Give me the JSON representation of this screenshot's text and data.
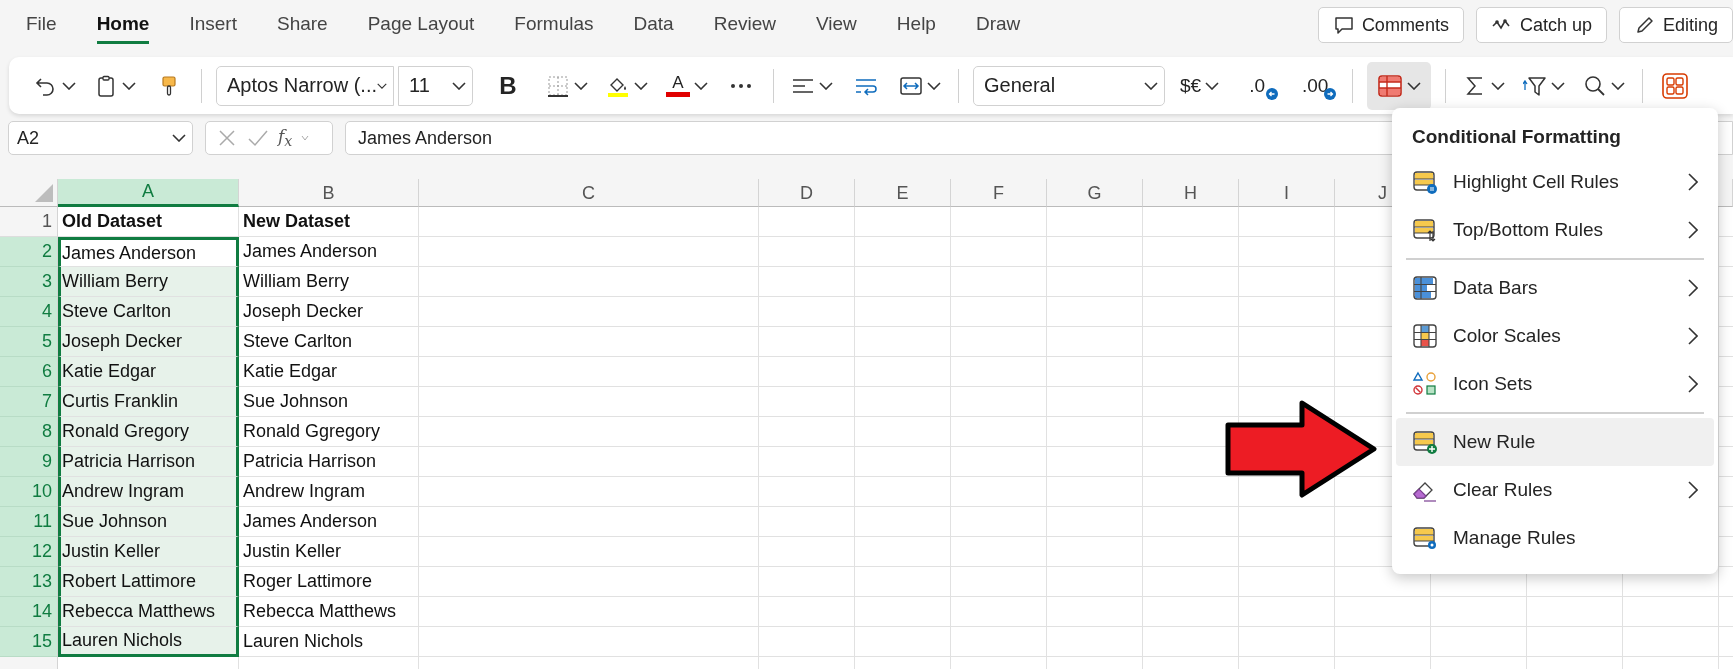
{
  "tabs": [
    {
      "label": "File",
      "selected": false
    },
    {
      "label": "Home",
      "selected": true
    },
    {
      "label": "Insert",
      "selected": false
    },
    {
      "label": "Share",
      "selected": false
    },
    {
      "label": "Page Layout",
      "selected": false
    },
    {
      "label": "Formulas",
      "selected": false
    },
    {
      "label": "Data",
      "selected": false
    },
    {
      "label": "Review",
      "selected": false
    },
    {
      "label": "View",
      "selected": false
    },
    {
      "label": "Help",
      "selected": false
    },
    {
      "label": "Draw",
      "selected": false
    }
  ],
  "header_buttons": [
    {
      "kind": "comments",
      "label": "Comments"
    },
    {
      "kind": "catchup",
      "label": "Catch up"
    },
    {
      "kind": "editing",
      "label": "Editing"
    }
  ],
  "ribbon": [
    {
      "kind": "undo",
      "caret": true
    },
    {
      "kind": "clipboard",
      "caret": true
    },
    {
      "kind": "painter",
      "caret": false
    },
    {
      "kind": "sep"
    },
    {
      "kind": "font",
      "value": "Aptos Narrow (...",
      "caret": true
    },
    {
      "kind": "size",
      "value": "11",
      "caret": true
    },
    {
      "kind": "bold",
      "glyph": "B",
      "caret": false
    },
    {
      "kind": "borders",
      "caret": true
    },
    {
      "kind": "fill",
      "caret": true
    },
    {
      "kind": "fontcolor",
      "glyph": "A",
      "caret": true
    },
    {
      "kind": "more",
      "caret": false
    },
    {
      "kind": "sep"
    },
    {
      "kind": "align",
      "caret": true
    },
    {
      "kind": "wrap",
      "caret": false
    },
    {
      "kind": "merge",
      "caret": true
    },
    {
      "kind": "sep"
    },
    {
      "kind": "numfmt",
      "value": "General",
      "caret": true
    },
    {
      "kind": "currency",
      "glyph": "$€",
      "caret": true
    },
    {
      "kind": "decdec",
      "glyph": ".0",
      "caret": false
    },
    {
      "kind": "incdec",
      "glyph": ".00",
      "caret": false
    },
    {
      "kind": "sep"
    },
    {
      "kind": "condfmt",
      "caret": true,
      "pressed": true
    },
    {
      "kind": "sep"
    },
    {
      "kind": "sum",
      "caret": true
    },
    {
      "kind": "sortfilter",
      "caret": true
    },
    {
      "kind": "find",
      "caret": true
    },
    {
      "kind": "sep"
    },
    {
      "kind": "addins",
      "caret": false
    }
  ],
  "formula_bar": {
    "name_box": "A2",
    "function_label": "f$_{x}$",
    "value": "James Anderson"
  },
  "sheet": {
    "columns": [
      {
        "label": "A",
        "selected": true
      },
      {
        "label": "B",
        "selected": false
      },
      {
        "label": "C",
        "selected": false
      },
      {
        "label": "D",
        "selected": false
      },
      {
        "label": "E",
        "selected": false
      },
      {
        "label": "F",
        "selected": false
      },
      {
        "label": "G",
        "selected": false
      },
      {
        "label": "H",
        "selected": false
      },
      {
        "label": "I",
        "selected": false
      },
      {
        "label": "J",
        "selected": false
      }
    ],
    "rows": [
      {
        "number": "1",
        "kind": "header",
        "selected": false,
        "cells": [
          "Old Dataset",
          "New Dataset"
        ]
      },
      {
        "number": "2",
        "kind": "data",
        "selected": true,
        "cells": [
          "James Anderson",
          "James Anderson"
        ]
      },
      {
        "number": "3",
        "kind": "data",
        "selected": true,
        "cells": [
          "William Berry",
          "William Berry"
        ]
      },
      {
        "number": "4",
        "kind": "data",
        "selected": true,
        "cells": [
          "Steve Carlton",
          "Joseph Decker"
        ]
      },
      {
        "number": "5",
        "kind": "data",
        "selected": true,
        "cells": [
          "Joseph Decker",
          "Steve Carlton"
        ]
      },
      {
        "number": "6",
        "kind": "data",
        "selected": true,
        "cells": [
          "Katie Edgar",
          "Katie Edgar"
        ]
      },
      {
        "number": "7",
        "kind": "data",
        "selected": true,
        "cells": [
          "Curtis Franklin",
          "Sue Johnson"
        ]
      },
      {
        "number": "8",
        "kind": "data",
        "selected": true,
        "cells": [
          "Ronald Gregory",
          "Ronald Ggregory"
        ]
      },
      {
        "number": "9",
        "kind": "data",
        "selected": true,
        "cells": [
          "Patricia Harrison",
          "Patricia Harrison"
        ]
      },
      {
        "number": "10",
        "kind": "data",
        "selected": true,
        "cells": [
          "Andrew Ingram",
          "Andrew Ingram"
        ]
      },
      {
        "number": "11",
        "kind": "data",
        "selected": true,
        "cells": [
          "Sue Johnson",
          "James Anderson"
        ]
      },
      {
        "number": "12",
        "kind": "data",
        "selected": true,
        "cells": [
          "Justin Keller",
          "Justin Keller"
        ]
      },
      {
        "number": "13",
        "kind": "data",
        "selected": true,
        "cells": [
          "Robert Lattimore",
          "Roger Lattimore"
        ]
      },
      {
        "number": "14",
        "kind": "data",
        "selected": true,
        "cells": [
          "Rebecca Matthews",
          "Rebecca Matthews"
        ]
      },
      {
        "number": "15",
        "kind": "data",
        "selected": true,
        "cells": [
          "Lauren Nichols",
          "Lauren Nichols"
        ]
      }
    ]
  },
  "menu": {
    "title": "Conditional Formatting",
    "groups": [
      [
        {
          "kind": "highlight",
          "label": "Highlight Cell Rules",
          "submenu": true,
          "selected": false
        },
        {
          "kind": "topbottom",
          "label": "Top/Bottom Rules",
          "submenu": true,
          "selected": false
        }
      ],
      [
        {
          "kind": "databars",
          "label": "Data Bars",
          "submenu": true,
          "selected": false
        },
        {
          "kind": "colorscales",
          "label": "Color Scales",
          "submenu": true,
          "selected": false
        },
        {
          "kind": "iconsets",
          "label": "Icon Sets",
          "submenu": true,
          "selected": false
        }
      ],
      [
        {
          "kind": "newrule",
          "label": "New Rule",
          "submenu": false,
          "selected": true
        },
        {
          "kind": "clear",
          "label": "Clear Rules",
          "submenu": true,
          "selected": false
        },
        {
          "kind": "manage",
          "label": "Manage Rules",
          "submenu": false,
          "selected": false
        }
      ]
    ]
  }
}
